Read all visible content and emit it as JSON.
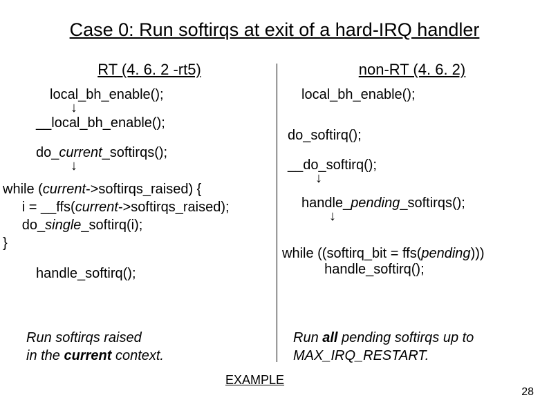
{
  "title": "Case 0: Run softirqs at exit of a hard-IRQ handler",
  "left": {
    "heading": "RT (4. 6. 2 -rt5)",
    "f1": "local_bh_enable();",
    "f2": "__local_bh_enable();",
    "f3_pre": "do_",
    "f3_it": "current",
    "f3_post": "_softirqs();",
    "while_pre": "while (",
    "while_it1": "current",
    "while_mid1": "->softirqs_raised) {",
    "line2_pre": "     i = __ffs(",
    "line2_it": "current",
    "line2_post": "->softirqs_raised);",
    "line3_pre": "     do_",
    "line3_it": "single",
    "line3_post": "_softirq(i);",
    "line4": "}",
    "f4": "handle_softirq();",
    "summary1": "Run softirqs raised",
    "summary2_pre": "in the ",
    "summary2_b": "current",
    "summary2_post": " context."
  },
  "right": {
    "heading": "non-RT (4. 6. 2)",
    "f1": "local_bh_enable();",
    "f2": "do_softirq();",
    "f3": "__do_softirq();",
    "f4_pre": "handle_",
    "f4_it": "pending",
    "f4_post": "_softirqs();",
    "while_pre": "while ((softirq_bit = ffs(",
    "while_it": "pending",
    "while_post": ")))",
    "line2": "           handle_softirq();",
    "summary1_pre": "Run ",
    "summary1_b": "all",
    "summary1_post": " pending softirqs up to",
    "summary2": "MAX_IRQ_RESTART."
  },
  "example": "EXAMPLE",
  "pagenum": "28"
}
